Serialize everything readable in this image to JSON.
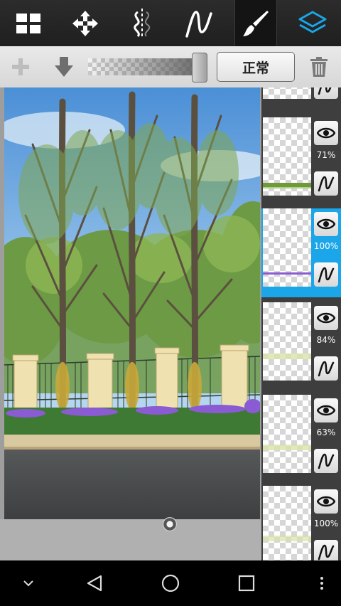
{
  "toolbar": {
    "tools": [
      {
        "icon": "grid-icon"
      },
      {
        "icon": "move-icon"
      },
      {
        "icon": "symmetry-icon"
      },
      {
        "icon": "curve-icon"
      },
      {
        "icon": "brush-icon"
      },
      {
        "icon": "layers-icon"
      }
    ]
  },
  "layer_bar": {
    "add_icon": "plus-icon",
    "merge_icon": "arrow-down-icon",
    "opacity_value": 1.0,
    "blend_mode": "正常",
    "delete_icon": "trash-icon"
  },
  "layers": [
    {
      "opacity": "",
      "selected": false
    },
    {
      "opacity": "71%",
      "selected": false
    },
    {
      "opacity": "100%",
      "selected": true
    },
    {
      "opacity": "84%",
      "selected": false
    },
    {
      "opacity": "63%",
      "selected": false
    },
    {
      "opacity": "100%",
      "selected": false
    }
  ],
  "colors": {
    "accent": "#1aa6e8",
    "toolbar_bg": "#262626",
    "panel_bg": "#3e3e3e"
  },
  "navbar": {
    "icons": [
      "chevron-down-icon",
      "back-icon",
      "home-icon",
      "recents-icon",
      "menu-icon"
    ]
  }
}
